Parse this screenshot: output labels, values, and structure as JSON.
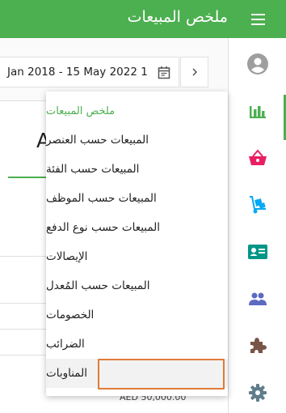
{
  "header": {
    "title": "ملخص المبيعات",
    "menu_icon": "hamburger-menu-icon",
    "color": "#4caf50"
  },
  "toolbar": {
    "date_range": "Jan 2018 - 15 May 2022 1",
    "calendar_icon": "calendar-icon",
    "next_icon": "chevron-right-icon"
  },
  "main": {
    "tab_label": "A",
    "amount": "AED 50,000.00"
  },
  "nav_rail": {
    "items": [
      {
        "name": "account",
        "icon": "account-circle-icon",
        "color": "#9e9e9e"
      },
      {
        "name": "reports",
        "icon": "bar-chart-icon",
        "color": "#4caf50",
        "active": true
      },
      {
        "name": "sales",
        "icon": "basket-icon",
        "color": "#e91e63"
      },
      {
        "name": "inventory",
        "icon": "hand-truck-icon",
        "color": "#03a9f4"
      },
      {
        "name": "customers",
        "icon": "contact-card-icon",
        "color": "#009688"
      },
      {
        "name": "employees",
        "icon": "people-icon",
        "color": "#5c6bc0"
      },
      {
        "name": "add-ons",
        "icon": "puzzle-icon",
        "color": "#795548"
      },
      {
        "name": "settings",
        "icon": "gear-icon",
        "color": "#607d8b"
      }
    ]
  },
  "dropdown": {
    "items": [
      {
        "label": "ملخص المبيعات",
        "selected": true
      },
      {
        "label": "المبيعات حسب العنصر"
      },
      {
        "label": "المبيعات حسب الفئة"
      },
      {
        "label": "المبيعات حسب الموظف"
      },
      {
        "label": "المبيعات حسب نوع الدفع"
      },
      {
        "label": "الإيصالات"
      },
      {
        "label": "المبيعات حسب المُعدل"
      },
      {
        "label": "الخصومات"
      },
      {
        "label": "الضرائب"
      },
      {
        "label": "المناوبات",
        "highlighted": true
      }
    ]
  },
  "colors": {
    "accent": "#4caf50",
    "highlight_border": "#e07b39"
  }
}
